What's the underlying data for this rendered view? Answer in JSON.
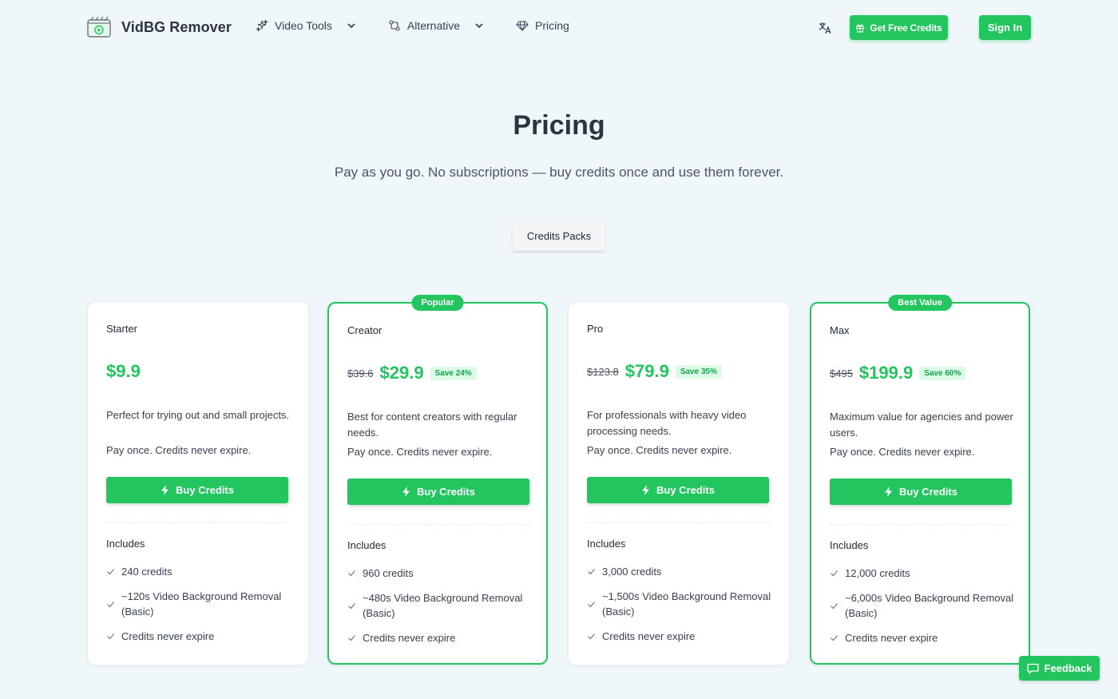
{
  "brand": {
    "name": "VidBG Remover"
  },
  "nav": {
    "items": [
      {
        "label": "Video Tools",
        "icon": "sparkles-icon",
        "dropdown": true
      },
      {
        "label": "Alternative",
        "icon": "swap-icon",
        "dropdown": true
      },
      {
        "label": "Pricing",
        "icon": "diamond-icon",
        "dropdown": false
      }
    ]
  },
  "header": {
    "free_credits_label": "Get Free Credits",
    "signin_label": "Sign In"
  },
  "hero": {
    "title": "Pricing",
    "subtitle": "Pay as you go. No subscriptions — buy credits once and use them forever.",
    "tab_label": "Credits Packs"
  },
  "plans": [
    {
      "name": "Starter",
      "badge": "",
      "old_price": "",
      "price": "$9.9",
      "save": "",
      "description": "Perfect for trying out and small projects.",
      "note": "Pay once. Credits never expire.",
      "button": "Buy Credits",
      "includes_label": "Includes",
      "features": [
        "240 credits",
        "~120s Video Background Removal (Basic)",
        "Credits never expire"
      ]
    },
    {
      "name": "Creator",
      "badge": "Popular",
      "old_price": "$39.6",
      "price": "$29.9",
      "save": "Save 24%",
      "description": "Best for content creators with regular needs.",
      "note": "Pay once. Credits never expire.",
      "button": "Buy Credits",
      "includes_label": "Includes",
      "features": [
        "960 credits",
        "~480s Video Background Removal (Basic)",
        "Credits never expire"
      ]
    },
    {
      "name": "Pro",
      "badge": "",
      "old_price": "$123.8",
      "price": "$79.9",
      "save": "Save 35%",
      "description": "For professionals with heavy video processing needs.",
      "note": "Pay once. Credits never expire.",
      "button": "Buy Credits",
      "includes_label": "Includes",
      "features": [
        "3,000 credits",
        "~1,500s Video Background Removal (Basic)",
        "Credits never expire"
      ]
    },
    {
      "name": "Max",
      "badge": "Best Value",
      "old_price": "$495",
      "price": "$199.9",
      "save": "Save 60%",
      "description": "Maximum value for agencies and power users.",
      "note": "Pay once. Credits never expire.",
      "button": "Buy Credits",
      "includes_label": "Includes",
      "features": [
        "12,000 credits",
        "~6,000s Video Background Removal (Basic)",
        "Credits never expire"
      ]
    }
  ],
  "feedback": {
    "label": "Feedback"
  },
  "colors": {
    "accent": "#22c55e",
    "background": "#f0f7fb",
    "save_bg": "#dcfce7"
  }
}
